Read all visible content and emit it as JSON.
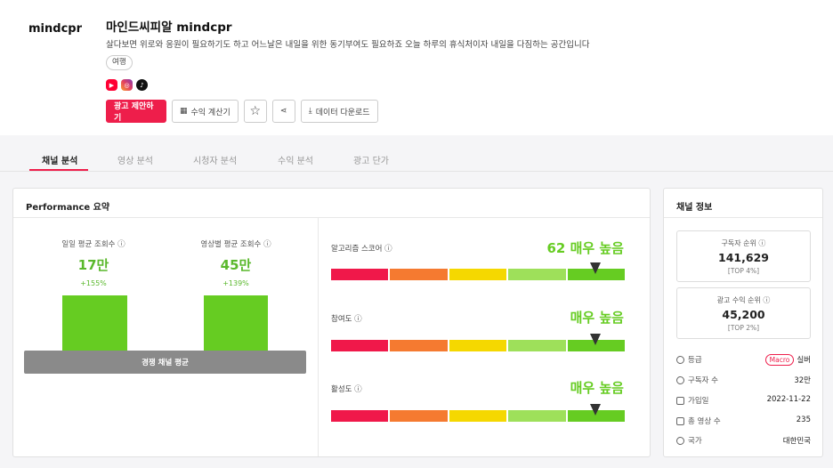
{
  "channel": {
    "logo_text": "mindcpr",
    "title": "마인드씨피알 mindcpr",
    "description": "살다보면 위로와 응원이 필요하기도 하고 어느날은 내일을 위한 동기부여도 필요하죠 오늘 하루의 휴식처이자 내일을 다짐하는 공간입니다",
    "tag": "여행",
    "socials": [
      "youtube-icon",
      "instagram-icon",
      "tiktok-icon"
    ]
  },
  "actions": {
    "propose_label": "광고 제안하기",
    "calc_label": "수익 계산기",
    "download_label": "데이터 다운로드"
  },
  "tabs": [
    {
      "label": "채널 분석"
    },
    {
      "label": "영상 분석"
    },
    {
      "label": "시청자 분석"
    },
    {
      "label": "수익 분석"
    },
    {
      "label": "광고 단가"
    }
  ],
  "performance": {
    "title": "Performance 요약",
    "metrics": [
      {
        "label": "일일 평균 조회수 ⓘ",
        "value": "17만",
        "change": "+155%"
      },
      {
        "label": "영상별 평균 조회수 ⓘ",
        "value": "45만",
        "change": "+139%"
      }
    ],
    "baseline_label": "경쟁 채널 평균",
    "scores": [
      {
        "label": "알고리즘 스코어 ⓘ",
        "value": "62 매우 높음",
        "level": 0.9
      },
      {
        "label": "참여도 ⓘ",
        "value": "매우 높음",
        "level": 0.9
      },
      {
        "label": "활성도 ⓘ",
        "value": "매우 높음",
        "level": 0.9
      }
    ],
    "gauge_colors": [
      "#f0184a",
      "#f57a30",
      "#f5d800",
      "#9ee05a",
      "#66cc22"
    ]
  },
  "channel_info": {
    "title": "채널 정보",
    "subscriber_rank": {
      "label": "구독자 순위 ⓘ",
      "value": "141,629",
      "top": "[TOP 4%]"
    },
    "revenue_rank": {
      "label": "광고 수익 순위 ⓘ",
      "value": "45,200",
      "top": "[TOP 2%]"
    },
    "rows": [
      {
        "key": "등급",
        "badge": "Macro",
        "value": "실버"
      },
      {
        "key": "구독자 수",
        "value": "32만"
      },
      {
        "key": "가입일",
        "value": "2022-11-22"
      },
      {
        "key": "총 영상 수",
        "value": "235"
      },
      {
        "key": "국가",
        "value": "대한민국"
      }
    ]
  }
}
